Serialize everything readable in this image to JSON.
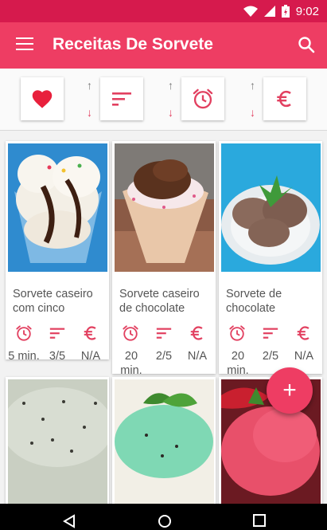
{
  "status_bar": {
    "time": "9:02"
  },
  "app_bar": {
    "title": "Receitas De Sorvete"
  },
  "filters": {
    "sort_up_glyph": "↑",
    "sort_down_glyph": "↓"
  },
  "colors": {
    "accent": "#ee3d63",
    "status_bar": "#d61a4d",
    "icon_red": "#e24060"
  },
  "recipes": [
    {
      "title": "Sorvete caseiro com cinco",
      "time": "5 min.",
      "difficulty": "3/5",
      "cost": "N/A"
    },
    {
      "title": "Sorvete caseiro de chocolate",
      "time": "20 min.",
      "difficulty": "2/5",
      "cost": "N/A"
    },
    {
      "title": "Sorvete de chocolate",
      "time": "20 min.",
      "difficulty": "2/5",
      "cost": "N/A"
    },
    {
      "title": "",
      "time": "",
      "difficulty": "",
      "cost": ""
    },
    {
      "title": "",
      "time": "",
      "difficulty": "",
      "cost": ""
    },
    {
      "title": "",
      "time": "",
      "difficulty": "",
      "cost": ""
    }
  ],
  "icons": {
    "favorite": "heart-icon",
    "sort": "sort-icon",
    "time": "alarm-clock-icon",
    "cost": "euro-icon",
    "add": "plus-icon"
  },
  "fab": {
    "label": "+"
  }
}
